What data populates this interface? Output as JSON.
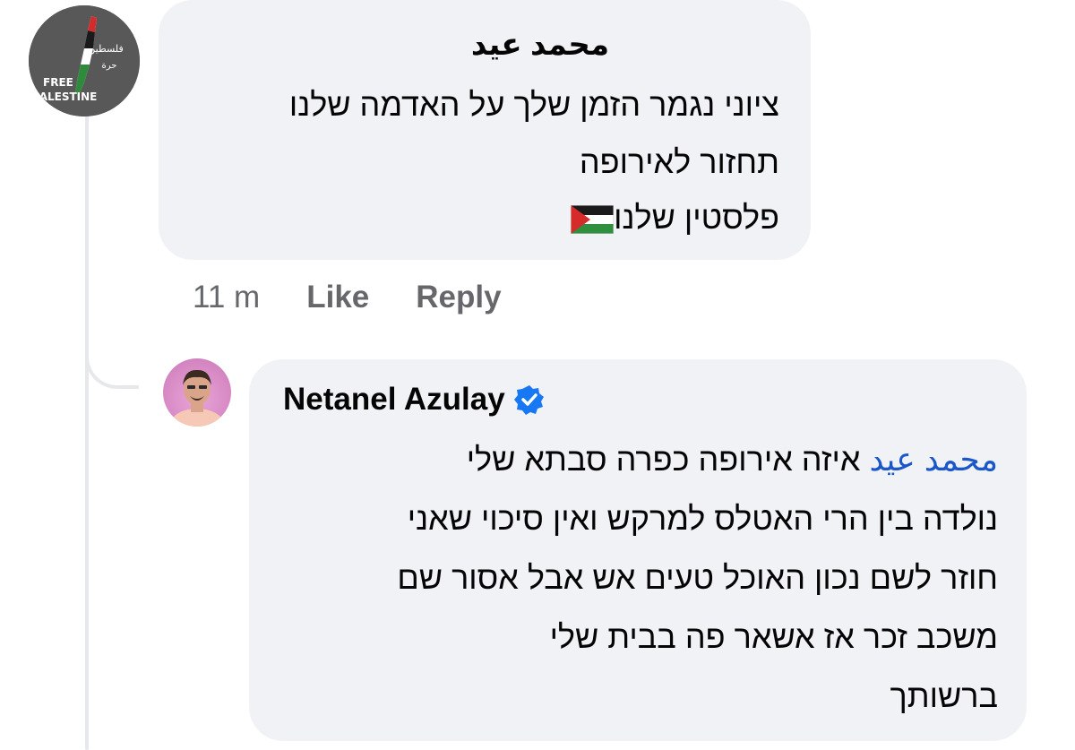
{
  "comment_1": {
    "author": "محمد عيد",
    "avatar_text": {
      "arabic_top": "فلسطين",
      "arabic_bottom": "حرة",
      "line1": "FREE",
      "line2": "PALESTINE"
    },
    "lines": [
      "ציוני נגמר הזמן שלך על האדמה שלנו",
      "תחזור לאירופה",
      "פלסטין שלנו"
    ],
    "flag_icon": "palestine-flag-icon",
    "actions": {
      "time": "11 m",
      "like": "Like",
      "reply": "Reply"
    }
  },
  "comment_2": {
    "author": "Netanel Azulay",
    "verified_icon": "verified-badge-icon",
    "mention": "محمد عيد",
    "lines": [
      "איזה אירופה כפרה סבתא שלי",
      "נולדה בין הרי האטלס למרקש ואין סיכוי שאני",
      "חוזר לשם נכון האוכל טעים אש אבל אסור שם",
      "משכב זכר אז אשאר פה בבית שלי",
      "ברשותך"
    ]
  },
  "colors": {
    "bubble": "#f0f2f5",
    "mention": "#1b57c9",
    "meta": "#65676b",
    "verified": "#1877f2"
  }
}
